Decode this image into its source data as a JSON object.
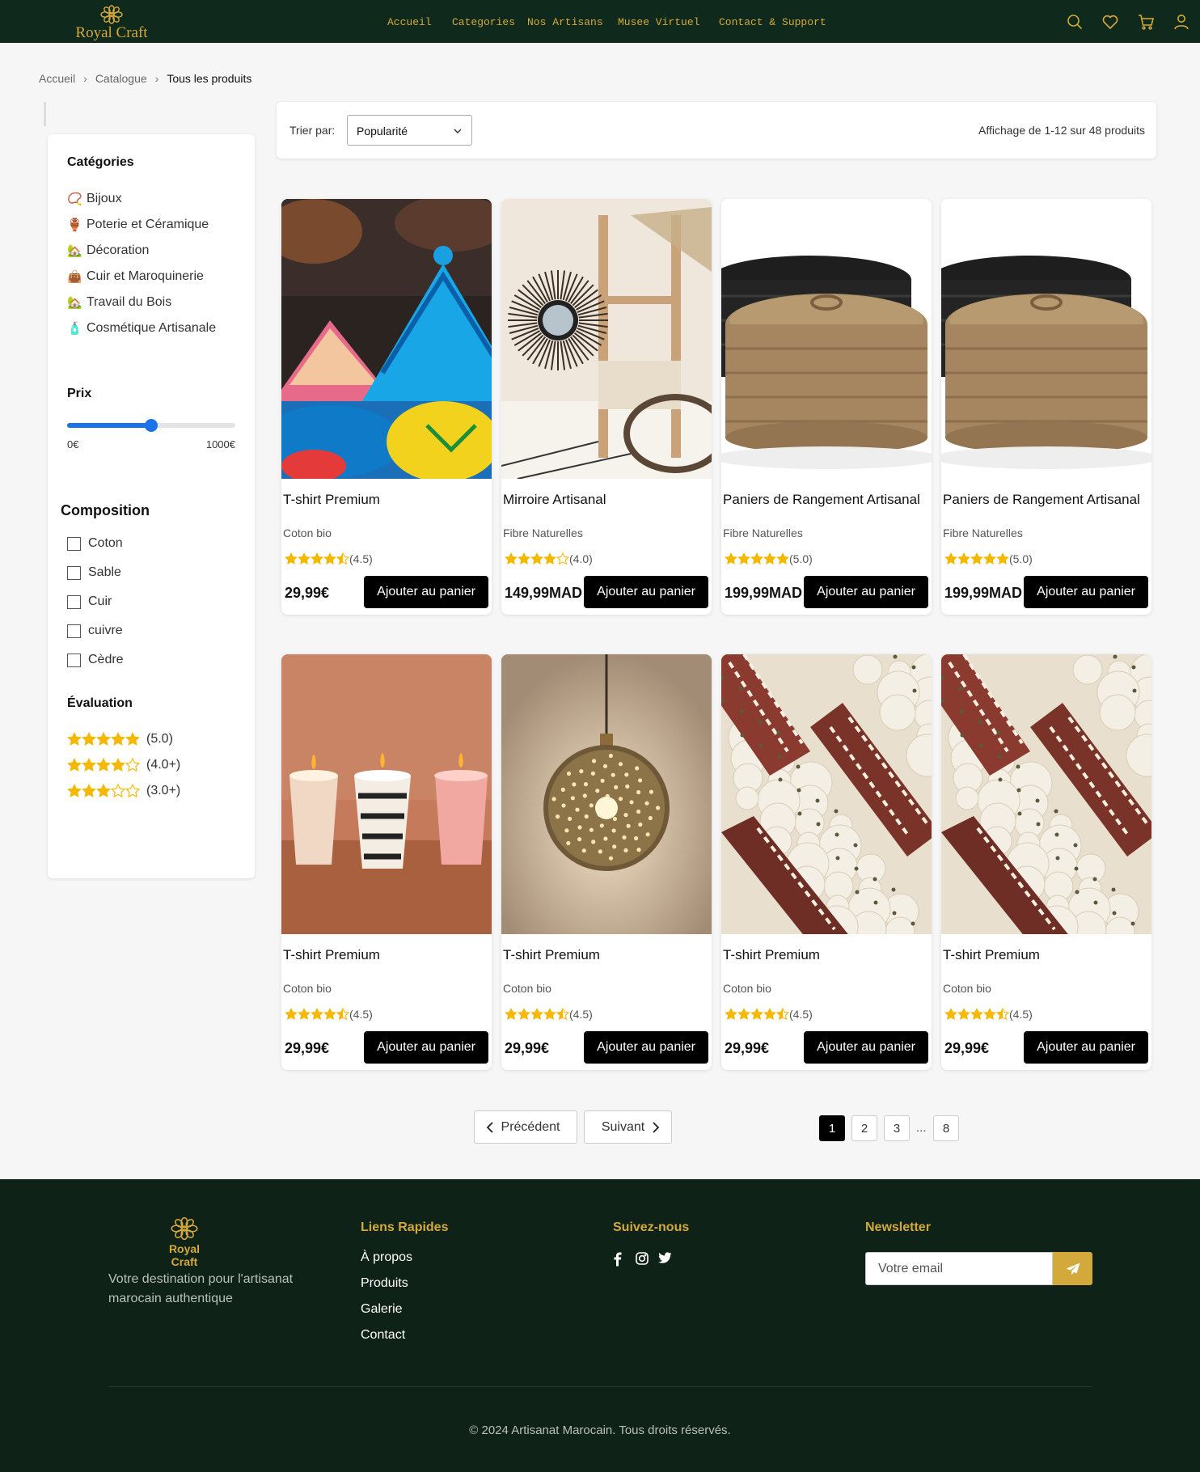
{
  "nav": {
    "brand": "Royal Craft",
    "links": [
      "Accueil",
      "Categories",
      "Nos Artisans",
      "Musee Virtuel",
      "Contact & Support"
    ],
    "icons": [
      "search-icon",
      "heart-icon",
      "cart-icon",
      "user-icon"
    ]
  },
  "breadcrumb": [
    "Accueil",
    "Catalogue",
    "Tous les produits"
  ],
  "sidebar": {
    "categories_title": "Catégories",
    "categories": [
      {
        "emoji": "📿",
        "label": "Bijoux"
      },
      {
        "emoji": "🏺",
        "label": "Poterie et Céramique"
      },
      {
        "emoji": "🏡",
        "label": "Décoration"
      },
      {
        "emoji": "👜",
        "label": "Cuir et Maroquinerie"
      },
      {
        "emoji": "🏡",
        "label": "Travail du Bois"
      },
      {
        "emoji": "🧴",
        "label": "Cosmétique Artisanale"
      }
    ],
    "price_title": "Prix",
    "price_min": "0€",
    "price_max": "1000€",
    "price_slider_fraction": 0.5,
    "composition_title": "Composition",
    "composition": [
      "Coton",
      "Sable",
      "Cuir",
      "cuivre",
      "Cèdre"
    ],
    "rating_title": "Évaluation",
    "ratings": [
      {
        "stars": 5,
        "label": "(5.0)"
      },
      {
        "stars": 4,
        "label": "(4.0+)"
      },
      {
        "stars": 3,
        "label": "(3.0+)"
      }
    ]
  },
  "toolbar": {
    "sort_label": "Trier par:",
    "sort_value": "Popularité",
    "result_count": "Affichage de 1-12 sur 48 produits"
  },
  "products": [
    {
      "name": "T-shirt Premium",
      "material": "Coton bio",
      "rating": 4.5,
      "rating_label": "(4.5)",
      "price": "29,99€",
      "button": "Ajouter au panier",
      "image": "tajines"
    },
    {
      "name": "Mirroire Artisanal",
      "material": "Fibre Naturelles",
      "rating": 4.0,
      "rating_label": "(4.0)",
      "price": "149,99MAD",
      "button": "Ajouter au panier",
      "image": "mirror"
    },
    {
      "name": "Paniers de Rangement Artisanal",
      "material": "Fibre Naturelles",
      "rating": 5.0,
      "rating_label": "(5.0)",
      "price": "199,99MAD",
      "button": "Ajouter au panier",
      "image": "baskets"
    },
    {
      "name": "Paniers de Rangement Artisanal",
      "material": "Fibre Naturelles",
      "rating": 5.0,
      "rating_label": "(5.0)",
      "price": "199,99MAD",
      "button": "Ajouter au panier",
      "image": "baskets"
    },
    {
      "name": "T-shirt Premium",
      "material": "Coton bio",
      "rating": 4.5,
      "rating_label": "(4.5)",
      "price": "29,99€",
      "button": "Ajouter au panier",
      "image": "candles"
    },
    {
      "name": "T-shirt Premium",
      "material": "Coton bio",
      "rating": 4.5,
      "rating_label": "(4.5)",
      "price": "29,99€",
      "button": "Ajouter au panier",
      "image": "lamp"
    },
    {
      "name": "T-shirt Premium",
      "material": "Coton bio",
      "rating": 4.5,
      "rating_label": "(4.5)",
      "price": "29,99€",
      "button": "Ajouter au panier",
      "image": "blanket"
    },
    {
      "name": "T-shirt Premium",
      "material": "Coton bio",
      "rating": 4.5,
      "rating_label": "(4.5)",
      "price": "29,99€",
      "button": "Ajouter au panier",
      "image": "blanket"
    }
  ],
  "pagination": {
    "prev": "Précédent",
    "next": "Suivant",
    "pages": [
      "1",
      "2",
      "3",
      "8"
    ],
    "ellipsis": "...",
    "current": "1"
  },
  "footer": {
    "brand": "Royal Craft",
    "tagline": "Votre destination pour l'artisanat marocain authentique",
    "links_title": "Liens Rapides",
    "links": [
      "À propos",
      "Produits",
      "Galerie",
      "Contact"
    ],
    "social_title": "Suivez-nous",
    "socials": [
      "facebook-icon",
      "instagram-icon",
      "twitter-icon"
    ],
    "newsletter_title": "Newsletter",
    "newsletter_placeholder": "Votre email",
    "copyright": "© 2024 Artisanat Marocain. Tous droits réservés."
  },
  "colors": {
    "nav_bg": "#0f2a1d",
    "footer_bg": "#0f2218",
    "gold": "#d4a93c",
    "star": "#f5b800",
    "slider": "#1a73e8"
  }
}
